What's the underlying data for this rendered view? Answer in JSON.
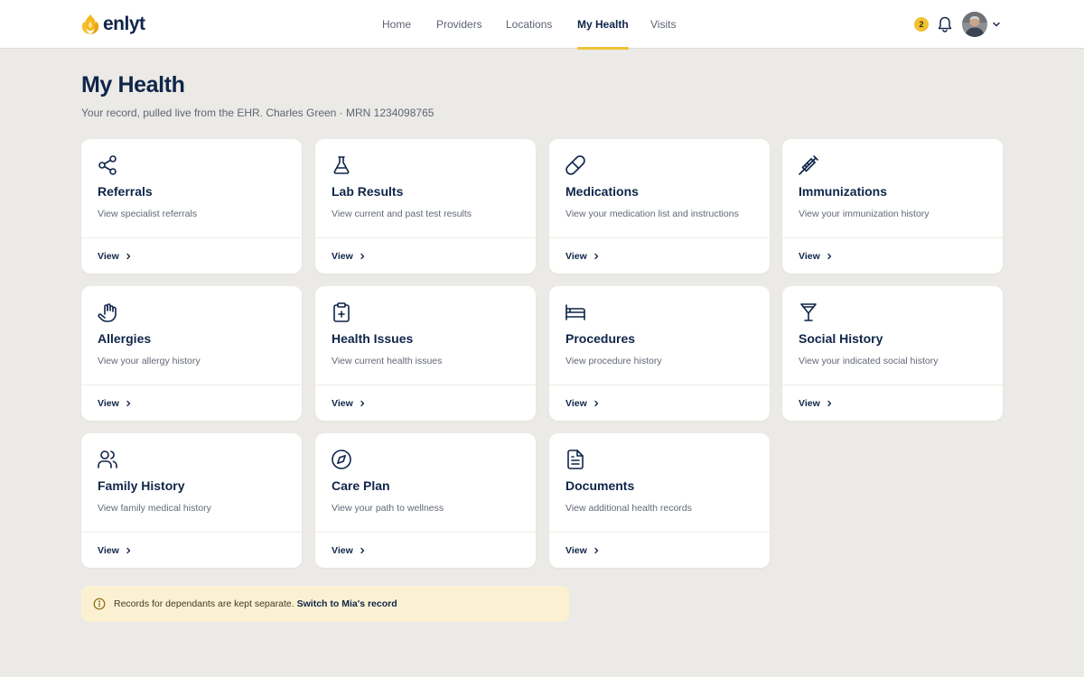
{
  "brand": {
    "name": "enlyt",
    "logo_icon": "flame-logo-icon",
    "accent": "#f0c232",
    "navy": "#0f2549"
  },
  "nav": {
    "items": [
      {
        "label": "Home",
        "active": false
      },
      {
        "label": "Providers",
        "active": false
      },
      {
        "label": "Locations",
        "active": false
      },
      {
        "label": "My Health",
        "active": true
      },
      {
        "label": "Visits",
        "active": false
      }
    ]
  },
  "header": {
    "notification_count": "2",
    "bell_icon": "bell-icon",
    "avatar_icon": "user-avatar",
    "menu_icon": "chevron-down-icon"
  },
  "page": {
    "title": "My Health",
    "subtitle": "Your record, pulled live from the EHR. Charles Green · MRN 1234098765"
  },
  "cards": [
    {
      "title": "Referrals",
      "description": "View specialist referrals",
      "link": "View",
      "icon": "share-nodes-icon"
    },
    {
      "title": "Lab Results",
      "description": "View current and past test results",
      "link": "View",
      "icon": "flask-icon"
    },
    {
      "title": "Medications",
      "description": "View your medication list and instructions",
      "link": "View",
      "icon": "pill-icon"
    },
    {
      "title": "Immunizations",
      "description": "View your immunization history",
      "link": "View",
      "icon": "syringe-icon"
    },
    {
      "title": "Allergies",
      "description": "View your allergy history",
      "link": "View",
      "icon": "hand-icon"
    },
    {
      "title": "Health Issues",
      "description": "View current health issues",
      "link": "View",
      "icon": "clipboard-plus-icon"
    },
    {
      "title": "Procedures",
      "description": "View procedure history",
      "link": "View",
      "icon": "bed-icon"
    },
    {
      "title": "Social History",
      "description": "View your indicated social history",
      "link": "View",
      "icon": "cocktail-glass-icon"
    },
    {
      "title": "Family History",
      "description": "View family medical history",
      "link": "View",
      "icon": "users-icon"
    },
    {
      "title": "Care Plan",
      "description": "View your path to wellness",
      "link": "View",
      "icon": "compass-icon"
    },
    {
      "title": "Documents",
      "description": "View additional health records",
      "link": "View",
      "icon": "document-icon"
    }
  ],
  "notice": {
    "text": "Records for dependants are kept separate.",
    "link": "Switch to Mia's record",
    "icon": "info-circle-icon"
  }
}
